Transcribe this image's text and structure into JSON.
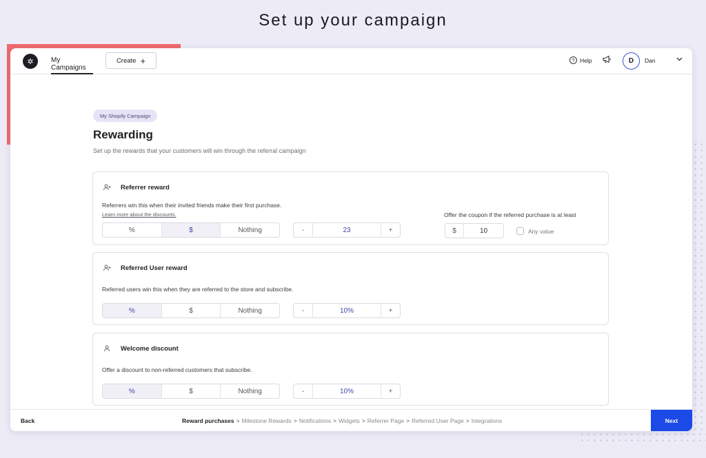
{
  "page_heading": "Set up your campaign",
  "topbar": {
    "logo_icon": "aperture-logo-icon",
    "tab_label": "My Campaigns",
    "create_label": "Create",
    "create_icon": "+",
    "help_label": "Help",
    "help_icon": "?",
    "announcements_icon": "megaphone-icon",
    "avatar_initial": "D",
    "user_name": "Dan",
    "chevron": "⌄"
  },
  "main": {
    "campaign_name": "My Shopify Campaign",
    "title": "Rewarding",
    "subtitle": "Set up the rewards that your customers will win through the referral campaign"
  },
  "cards": [
    {
      "title": "Referrer reward",
      "description": "Referrers win this when their invited friends make their first purchase.",
      "link": "Learn more about the discounts.",
      "options": [
        "%",
        "$",
        "Nothing"
      ],
      "selected": "$",
      "minus": "-",
      "value": "23",
      "plus": "+",
      "coupon_label": "Offer the coupon if the referred purchase is at least",
      "coupon_currency": "$",
      "coupon_value": "10",
      "any_value_label": "Any value"
    },
    {
      "title": "Referred User reward",
      "description": "Referred users win this when they are referred to the store and subscribe.",
      "options": [
        "%",
        "$",
        "Nothing"
      ],
      "selected": "%",
      "minus": "-",
      "value": "10%",
      "plus": "+"
    },
    {
      "title": "Welcome discount",
      "description": "Offer a discount to non-referred customers that subscribe.",
      "options": [
        "%",
        "$",
        "Nothing"
      ],
      "selected": "%",
      "minus": "-",
      "value": "10%",
      "plus": "+"
    }
  ],
  "footer": {
    "back_label": "Back",
    "steps": [
      "Reward purchases",
      "Milestone Rewards",
      "Notifications",
      "Widgets",
      "Referrer Page",
      "Referred User Page",
      "Integrations"
    ],
    "separator": ">",
    "next_label": "Next"
  },
  "colors": {
    "accent": "#1b4ae6",
    "coral": "#f06a6f",
    "selected_text": "#3f46a8"
  }
}
